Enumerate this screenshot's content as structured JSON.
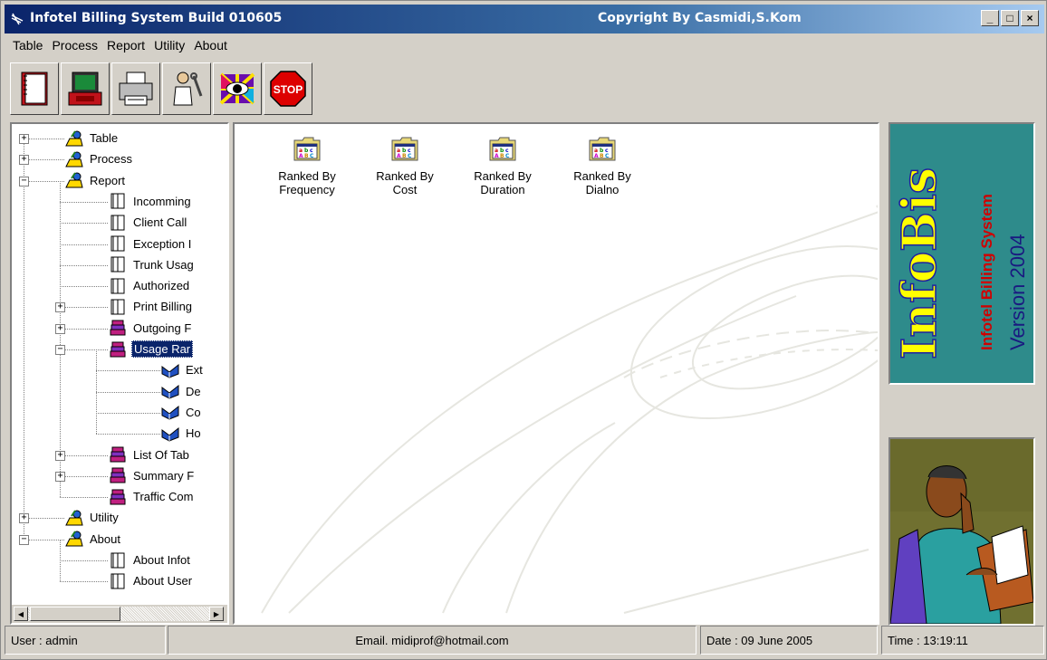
{
  "window": {
    "title": "Infotel Billing System  Build 010605",
    "copyright": "Copyright By Casmidi,S.Kom",
    "controls": [
      "_",
      "□",
      "×"
    ]
  },
  "menu": [
    "Table",
    "Process",
    "Report",
    "Utility",
    "About"
  ],
  "toolbar": [
    {
      "name": "notebook-tool-icon"
    },
    {
      "name": "phone-computer-tool-icon"
    },
    {
      "name": "printer-tool-icon"
    },
    {
      "name": "tools-person-tool-icon"
    },
    {
      "name": "colorful-eye-tool-icon"
    },
    {
      "name": "stop-sign-tool-icon",
      "label": "STOP"
    }
  ],
  "tree": {
    "items": [
      {
        "label": "Table",
        "level": 0,
        "icon": "folder-person-icon",
        "expander": "+"
      },
      {
        "label": "Process",
        "level": 0,
        "icon": "folder-person-icon",
        "expander": "+"
      },
      {
        "label": "Report",
        "level": 0,
        "icon": "folder-person-icon",
        "expander": "-"
      },
      {
        "label": "Incomming",
        "level": 1,
        "icon": "book-icon"
      },
      {
        "label": "Client Call",
        "level": 1,
        "icon": "book-icon"
      },
      {
        "label": "Exception I",
        "level": 1,
        "icon": "book-icon"
      },
      {
        "label": "Trunk Usag",
        "level": 1,
        "icon": "book-icon"
      },
      {
        "label": "Authorized",
        "level": 1,
        "icon": "book-icon"
      },
      {
        "label": "Print Billing",
        "level": 1,
        "icon": "book-icon",
        "expander": "+"
      },
      {
        "label": "Outgoing F",
        "level": 1,
        "icon": "books-stack-icon",
        "expander": "+"
      },
      {
        "label": "Usage Rar",
        "level": 1,
        "icon": "books-stack-icon",
        "expander": "-",
        "selected": true
      },
      {
        "label": "Ext",
        "level": 2,
        "icon": "open-book-icon"
      },
      {
        "label": "De",
        "level": 2,
        "icon": "open-book-icon"
      },
      {
        "label": "Co",
        "level": 2,
        "icon": "open-book-icon"
      },
      {
        "label": "Ho",
        "level": 2,
        "icon": "open-book-icon"
      },
      {
        "label": "List Of Tab",
        "level": 1,
        "icon": "books-stack-icon",
        "expander": "+"
      },
      {
        "label": "Summary F",
        "level": 1,
        "icon": "books-stack-icon",
        "expander": "+"
      },
      {
        "label": "Traffic Com",
        "level": 1,
        "icon": "books-stack-icon"
      },
      {
        "label": "Utility",
        "level": 0,
        "icon": "folder-person-icon",
        "expander": "+"
      },
      {
        "label": "About",
        "level": 0,
        "icon": "folder-person-icon",
        "expander": "-"
      },
      {
        "label": "About Infot",
        "level": 1,
        "icon": "book-icon"
      },
      {
        "label": "About User",
        "level": 1,
        "icon": "book-icon"
      }
    ]
  },
  "content": {
    "items": [
      {
        "line1": "Ranked By",
        "line2": "Frequency"
      },
      {
        "line1": "Ranked By",
        "line2": "Cost"
      },
      {
        "line1": "Ranked By",
        "line2": "Duration"
      },
      {
        "line1": "Ranked By",
        "line2": "Dialno"
      }
    ]
  },
  "logo": {
    "brand": "InfoBis",
    "subtitle": "Infotel Billing System",
    "version": "Version 2004"
  },
  "status": {
    "user": "User : admin",
    "email": "Email. midiprof@hotmail.com",
    "date": "Date : 09 June 2005",
    "time": "Time : 13:19:11"
  }
}
